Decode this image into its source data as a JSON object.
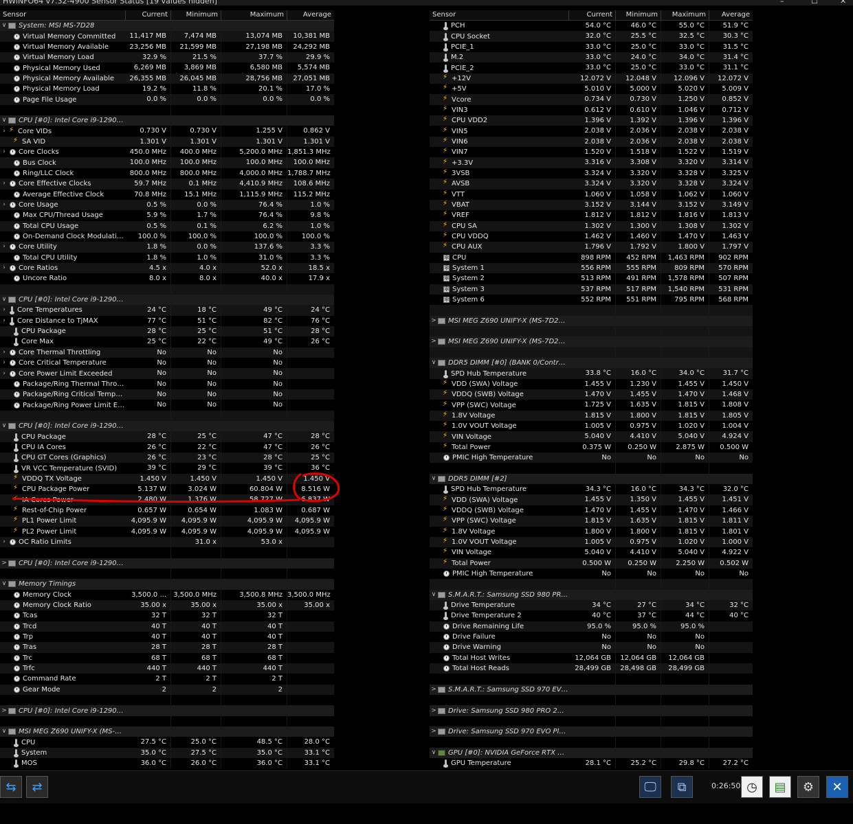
{
  "window": {
    "title": "HWiNFO64 v7.32-4900 Sensor Status [19 values hidden]",
    "min": "–",
    "max": "☐",
    "close": "✕"
  },
  "columns": {
    "sensor": "Sensor",
    "current": "Current",
    "minimum": "Minimum",
    "maximum": "Maximum",
    "average": "Average"
  },
  "left_rows": [
    {
      "t": "g",
      "exp": "∨",
      "name": "System: MSI MS-7D28"
    },
    {
      "ic": "clock",
      "name": "Virtual Memory Committed",
      "v": [
        "11,417 MB",
        "7,474 MB",
        "13,074 MB",
        "10,381 MB"
      ]
    },
    {
      "ic": "clock",
      "name": "Virtual Memory Available",
      "v": [
        "23,256 MB",
        "21,599 MB",
        "27,198 MB",
        "24,292 MB"
      ]
    },
    {
      "ic": "clock",
      "name": "Virtual Memory Load",
      "v": [
        "32.9 %",
        "21.5 %",
        "37.7 %",
        "29.9 %"
      ]
    },
    {
      "ic": "clock",
      "name": "Physical Memory Used",
      "v": [
        "6,269 MB",
        "3,869 MB",
        "6,580 MB",
        "5,574 MB"
      ]
    },
    {
      "ic": "clock",
      "name": "Physical Memory Available",
      "v": [
        "26,355 MB",
        "26,045 MB",
        "28,756 MB",
        "27,051 MB"
      ]
    },
    {
      "ic": "clock",
      "name": "Physical Memory Load",
      "v": [
        "19.2 %",
        "11.8 %",
        "20.1 %",
        "17.0 %"
      ]
    },
    {
      "ic": "clock",
      "name": "Page File Usage",
      "v": [
        "0.0 %",
        "0.0 %",
        "0.0 %",
        "0.0 %"
      ]
    },
    {
      "t": "s"
    },
    {
      "t": "g",
      "exp": "∨",
      "name": "CPU [#0]: Intel Core i9-12900K"
    },
    {
      "sub": true,
      "ic": "volt",
      "name": "Core VIDs",
      "v": [
        "0.730 V",
        "0.730 V",
        "1.255 V",
        "0.862 V"
      ]
    },
    {
      "ic": "volt",
      "name": "SA VID",
      "v": [
        "1.301 V",
        "1.301 V",
        "1.301 V",
        "1.301 V"
      ]
    },
    {
      "sub": true,
      "ic": "clock",
      "name": "Core Clocks",
      "v": [
        "450.0 MHz",
        "400.0 MHz",
        "5,200.0 MHz",
        "1,851.3 MHz"
      ]
    },
    {
      "ic": "clock",
      "name": "Bus Clock",
      "v": [
        "100.0 MHz",
        "100.0 MHz",
        "100.0 MHz",
        "100.0 MHz"
      ]
    },
    {
      "ic": "clock",
      "name": "Ring/LLC Clock",
      "v": [
        "800.0 MHz",
        "800.0 MHz",
        "4,000.0 MHz",
        "1,788.7 MHz"
      ]
    },
    {
      "sub": true,
      "ic": "clock",
      "name": "Core Effective Clocks",
      "v": [
        "59.7 MHz",
        "0.1 MHz",
        "4,410.9 MHz",
        "108.6 MHz"
      ]
    },
    {
      "ic": "clock",
      "name": "Average Effective Clock",
      "v": [
        "70.8 MHz",
        "15.1 MHz",
        "1,115.9 MHz",
        "115.2 MHz"
      ]
    },
    {
      "sub": true,
      "ic": "clock",
      "name": "Core Usage",
      "v": [
        "0.5 %",
        "0.0 %",
        "76.4 %",
        "1.0 %"
      ]
    },
    {
      "ic": "clock",
      "name": "Max CPU/Thread Usage",
      "v": [
        "5.9 %",
        "1.7 %",
        "76.4 %",
        "9.8 %"
      ]
    },
    {
      "ic": "clock",
      "name": "Total CPU Usage",
      "v": [
        "0.5 %",
        "0.1 %",
        "6.2 %",
        "1.0 %"
      ]
    },
    {
      "ic": "clock",
      "name": "On-Demand Clock Modulation",
      "v": [
        "100.0 %",
        "100.0 %",
        "100.0 %",
        "100.0 %"
      ]
    },
    {
      "sub": true,
      "ic": "clock",
      "name": "Core Utility",
      "v": [
        "1.8 %",
        "0.0 %",
        "137.6 %",
        "3.3 %"
      ]
    },
    {
      "ic": "clock",
      "name": "Total CPU Utility",
      "v": [
        "1.8 %",
        "1.0 %",
        "31.0 %",
        "3.3 %"
      ]
    },
    {
      "sub": true,
      "ic": "clock",
      "name": "Core Ratios",
      "v": [
        "4.5 x",
        "4.0 x",
        "52.0 x",
        "18.5 x"
      ]
    },
    {
      "ic": "clock",
      "name": "Uncore Ratio",
      "v": [
        "8.0 x",
        "8.0 x",
        "40.0 x",
        "17.9 x"
      ]
    },
    {
      "t": "s"
    },
    {
      "t": "g",
      "exp": "∨",
      "name": "CPU [#0]: Intel Core i9-12900..."
    },
    {
      "sub": true,
      "ic": "temp",
      "name": "Core Temperatures",
      "v": [
        "24 °C",
        "18 °C",
        "49 °C",
        "24 °C"
      ]
    },
    {
      "sub": true,
      "ic": "temp",
      "name": "Core Distance to TjMAX",
      "v": [
        "77 °C",
        "51 °C",
        "82 °C",
        "76 °C"
      ]
    },
    {
      "ic": "temp",
      "name": "CPU Package",
      "v": [
        "28 °C",
        "25 °C",
        "51 °C",
        "28 °C"
      ]
    },
    {
      "ic": "temp",
      "name": "Core Max",
      "v": [
        "25 °C",
        "22 °C",
        "49 °C",
        "26 °C"
      ]
    },
    {
      "sub": true,
      "ic": "clock",
      "name": "Core Thermal Throttling",
      "v": [
        "No",
        "No",
        "No",
        ""
      ]
    },
    {
      "sub": true,
      "ic": "clock",
      "name": "Core Critical Temperature",
      "v": [
        "No",
        "No",
        "No",
        ""
      ]
    },
    {
      "sub": true,
      "ic": "clock",
      "name": "Core Power Limit Exceeded",
      "v": [
        "No",
        "No",
        "No",
        ""
      ]
    },
    {
      "ic": "clock",
      "name": "Package/Ring Thermal Throttling",
      "v": [
        "No",
        "No",
        "No",
        ""
      ]
    },
    {
      "ic": "clock",
      "name": "Package/Ring Critical Temperat...",
      "v": [
        "No",
        "No",
        "No",
        ""
      ]
    },
    {
      "ic": "clock",
      "name": "Package/Ring Power Limit Exce...",
      "v": [
        "No",
        "No",
        "No",
        ""
      ]
    },
    {
      "t": "s"
    },
    {
      "t": "g",
      "exp": "∨",
      "name": "CPU [#0]: Intel Core i9-12900..."
    },
    {
      "ic": "temp",
      "name": "CPU Package",
      "v": [
        "28 °C",
        "25 °C",
        "47 °C",
        "28 °C"
      ]
    },
    {
      "ic": "temp",
      "name": "CPU IA Cores",
      "v": [
        "26 °C",
        "22 °C",
        "47 °C",
        "26 °C"
      ]
    },
    {
      "ic": "temp",
      "name": "CPU GT Cores (Graphics)",
      "v": [
        "26 °C",
        "23 °C",
        "28 °C",
        "25 °C"
      ]
    },
    {
      "ic": "temp",
      "name": "VR VCC Temperature (SVID)",
      "v": [
        "39 °C",
        "29 °C",
        "39 °C",
        "36 °C"
      ]
    },
    {
      "ic": "volt",
      "name": "VDDQ TX Voltage",
      "v": [
        "1.450 V",
        "1.450 V",
        "1.450 V",
        "1.450 V"
      ]
    },
    {
      "ic": "volt",
      "name": "CPU Package Power",
      "v": [
        "5.137 W",
        "3.024 W",
        "60.804 W",
        "8.516 W"
      ]
    },
    {
      "ic": "volt",
      "name": "IA Cores Power",
      "v": [
        "2.480 W",
        "1.376 W",
        "58.727 W",
        "6.837 W"
      ]
    },
    {
      "ic": "volt",
      "name": "Rest-of-Chip Power",
      "v": [
        "0.657 W",
        "0.654 W",
        "1.083 W",
        "0.687 W"
      ]
    },
    {
      "ic": "volt",
      "name": "PL1 Power Limit",
      "v": [
        "4,095.9 W",
        "4,095.9 W",
        "4,095.9 W",
        "4,095.9 W"
      ]
    },
    {
      "ic": "volt",
      "name": "PL2 Power Limit",
      "v": [
        "4,095.9 W",
        "4,095.9 W",
        "4,095.9 W",
        "4,095.9 W"
      ]
    },
    {
      "sub": true,
      "ic": "clock",
      "name": "OC Ratio Limits",
      "v": [
        "",
        "31.0 x",
        "53.0 x",
        ""
      ]
    },
    {
      "t": "s"
    },
    {
      "t": "g",
      "exp": ">",
      "name": "CPU [#0]: Intel Core i9-12900..."
    },
    {
      "t": "s"
    },
    {
      "t": "g",
      "exp": "∨",
      "name": "Memory Timings"
    },
    {
      "ic": "clock",
      "name": "Memory Clock",
      "v": [
        "3,500.0 ...",
        "3,500.0 MHz",
        "3,500.8 MHz",
        "3,500.0 MHz"
      ]
    },
    {
      "ic": "clock",
      "name": "Memory Clock Ratio",
      "v": [
        "35.00 x",
        "35.00 x",
        "35.00 x",
        "35.00 x"
      ]
    },
    {
      "ic": "clock",
      "name": "Tcas",
      "v": [
        "32 T",
        "32 T",
        "32 T",
        ""
      ]
    },
    {
      "ic": "clock",
      "name": "Trcd",
      "v": [
        "40 T",
        "40 T",
        "40 T",
        ""
      ]
    },
    {
      "ic": "clock",
      "name": "Trp",
      "v": [
        "40 T",
        "40 T",
        "40 T",
        ""
      ]
    },
    {
      "ic": "clock",
      "name": "Tras",
      "v": [
        "28 T",
        "28 T",
        "28 T",
        ""
      ]
    },
    {
      "ic": "clock",
      "name": "Trc",
      "v": [
        "68 T",
        "68 T",
        "68 T",
        ""
      ]
    },
    {
      "ic": "clock",
      "name": "Trfc",
      "v": [
        "440 T",
        "440 T",
        "440 T",
        ""
      ]
    },
    {
      "ic": "clock",
      "name": "Command Rate",
      "v": [
        "2 T",
        "2 T",
        "2 T",
        ""
      ]
    },
    {
      "ic": "clock",
      "name": "Gear Mode",
      "v": [
        "2",
        "2",
        "2",
        ""
      ]
    },
    {
      "t": "s"
    },
    {
      "t": "g",
      "exp": ">",
      "name": "CPU [#0]: Intel Core i9-12900..."
    },
    {
      "t": "s"
    },
    {
      "t": "g",
      "exp": "∨",
      "name": "MSI MEG Z690 UNIFY-X (MS-7..."
    },
    {
      "ic": "temp",
      "name": "CPU",
      "v": [
        "27.5 °C",
        "25.0 °C",
        "48.5 °C",
        "28.0 °C"
      ]
    },
    {
      "ic": "temp",
      "name": "System",
      "v": [
        "35.0 °C",
        "27.5 °C",
        "35.0 °C",
        "33.1 °C"
      ]
    },
    {
      "ic": "temp",
      "name": "MOS",
      "v": [
        "36.0 °C",
        "26.0 °C",
        "36.0 °C",
        "33.1 °C"
      ]
    }
  ],
  "right_rows": [
    {
      "ic": "temp",
      "name": "PCH",
      "v": [
        "54.0 °C",
        "46.0 °C",
        "55.0 °C",
        "51.9 °C"
      ]
    },
    {
      "ic": "temp",
      "name": "CPU Socket",
      "v": [
        "32.0 °C",
        "25.5 °C",
        "32.5 °C",
        "30.3 °C"
      ]
    },
    {
      "ic": "temp",
      "name": "PCIE_1",
      "v": [
        "33.0 °C",
        "25.0 °C",
        "33.0 °C",
        "31.5 °C"
      ]
    },
    {
      "ic": "temp",
      "name": "M.2",
      "v": [
        "33.0 °C",
        "24.0 °C",
        "34.0 °C",
        "31.4 °C"
      ]
    },
    {
      "ic": "temp",
      "name": "PCIE_2",
      "v": [
        "33.0 °C",
        "25.0 °C",
        "33.0 °C",
        "31.1 °C"
      ]
    },
    {
      "ic": "volt",
      "name": "+12V",
      "v": [
        "12.072 V",
        "12.048 V",
        "12.096 V",
        "12.072 V"
      ]
    },
    {
      "ic": "volt",
      "name": "+5V",
      "v": [
        "5.010 V",
        "5.000 V",
        "5.020 V",
        "5.009 V"
      ]
    },
    {
      "ic": "volt",
      "name": "Vcore",
      "v": [
        "0.734 V",
        "0.730 V",
        "1.250 V",
        "0.852 V"
      ]
    },
    {
      "ic": "volt",
      "name": "VIN3",
      "v": [
        "0.612 V",
        "0.610 V",
        "1.046 V",
        "0.712 V"
      ]
    },
    {
      "ic": "volt",
      "name": "CPU VDD2",
      "v": [
        "1.396 V",
        "1.392 V",
        "1.396 V",
        "1.396 V"
      ]
    },
    {
      "ic": "volt",
      "name": "VIN5",
      "v": [
        "2.038 V",
        "2.036 V",
        "2.038 V",
        "2.038 V"
      ]
    },
    {
      "ic": "volt",
      "name": "VIN6",
      "v": [
        "2.038 V",
        "2.036 V",
        "2.038 V",
        "2.038 V"
      ]
    },
    {
      "ic": "volt",
      "name": "VIN7",
      "v": [
        "1.520 V",
        "1.518 V",
        "1.522 V",
        "1.519 V"
      ]
    },
    {
      "ic": "volt",
      "name": "+3.3V",
      "v": [
        "3.316 V",
        "3.308 V",
        "3.320 V",
        "3.314 V"
      ]
    },
    {
      "ic": "volt",
      "name": "3VSB",
      "v": [
        "3.324 V",
        "3.320 V",
        "3.328 V",
        "3.325 V"
      ]
    },
    {
      "ic": "volt",
      "name": "AVSB",
      "v": [
        "3.324 V",
        "3.320 V",
        "3.328 V",
        "3.324 V"
      ]
    },
    {
      "ic": "volt",
      "name": "VTT",
      "v": [
        "1.060 V",
        "1.058 V",
        "1.062 V",
        "1.060 V"
      ]
    },
    {
      "ic": "volt",
      "name": "VBAT",
      "v": [
        "3.152 V",
        "3.144 V",
        "3.152 V",
        "3.149 V"
      ]
    },
    {
      "ic": "volt",
      "name": "VREF",
      "v": [
        "1.812 V",
        "1.812 V",
        "1.816 V",
        "1.813 V"
      ]
    },
    {
      "ic": "volt",
      "name": "CPU SA",
      "v": [
        "1.302 V",
        "1.300 V",
        "1.308 V",
        "1.302 V"
      ]
    },
    {
      "ic": "volt",
      "name": "CPU VDDQ",
      "v": [
        "1.462 V",
        "1.460 V",
        "1.470 V",
        "1.463 V"
      ]
    },
    {
      "ic": "volt",
      "name": "CPU AUX",
      "v": [
        "1.796 V",
        "1.792 V",
        "1.800 V",
        "1.797 V"
      ]
    },
    {
      "ic": "fan",
      "name": "CPU",
      "v": [
        "898 RPM",
        "452 RPM",
        "1,463 RPM",
        "902 RPM"
      ]
    },
    {
      "ic": "fan",
      "name": "System 1",
      "v": [
        "556 RPM",
        "555 RPM",
        "809 RPM",
        "570 RPM"
      ]
    },
    {
      "ic": "fan",
      "name": "System 2",
      "v": [
        "513 RPM",
        "491 RPM",
        "1,578 RPM",
        "507 RPM"
      ]
    },
    {
      "ic": "fan",
      "name": "System 3",
      "v": [
        "537 RPM",
        "517 RPM",
        "1,540 RPM",
        "531 RPM"
      ]
    },
    {
      "ic": "fan",
      "name": "System 6",
      "v": [
        "552 RPM",
        "551 RPM",
        "795 RPM",
        "568 RPM"
      ]
    },
    {
      "t": "s"
    },
    {
      "t": "g",
      "exp": ">",
      "name": "MSI MEG Z690 UNIFY-X (MS-7D28) ..."
    },
    {
      "t": "s"
    },
    {
      "t": "g",
      "exp": ">",
      "name": "MSI MEG Z690 UNIFY-X (MS-7D28) ..."
    },
    {
      "t": "s"
    },
    {
      "t": "g",
      "exp": "∨",
      "name": "DDR5 DIMM [#0] (BANK 0/Controll..."
    },
    {
      "ic": "temp",
      "name": "SPD Hub Temperature",
      "v": [
        "33.8 °C",
        "16.0 °C",
        "34.0 °C",
        "31.7 °C"
      ]
    },
    {
      "ic": "volt",
      "name": "VDD (SWA) Voltage",
      "v": [
        "1.455 V",
        "1.230 V",
        "1.455 V",
        "1.450 V"
      ]
    },
    {
      "ic": "volt",
      "name": "VDDQ (SWB) Voltage",
      "v": [
        "1.470 V",
        "1.455 V",
        "1.470 V",
        "1.468 V"
      ]
    },
    {
      "ic": "volt",
      "name": "VPP (SWC) Voltage",
      "v": [
        "1.725 V",
        "1.635 V",
        "1.815 V",
        "1.808 V"
      ]
    },
    {
      "ic": "volt",
      "name": "1.8V Voltage",
      "v": [
        "1.815 V",
        "1.800 V",
        "1.815 V",
        "1.805 V"
      ]
    },
    {
      "ic": "volt",
      "name": "1.0V VOUT Voltage",
      "v": [
        "1.005 V",
        "0.975 V",
        "1.020 V",
        "1.004 V"
      ]
    },
    {
      "ic": "volt",
      "name": "VIN Voltage",
      "v": [
        "5.040 V",
        "4.410 V",
        "5.040 V",
        "4.924 V"
      ]
    },
    {
      "ic": "volt",
      "name": "Total Power",
      "v": [
        "0.375 W",
        "0.250 W",
        "2.875 W",
        "0.500 W"
      ]
    },
    {
      "ic": "clock",
      "name": "PMIC High Temperature",
      "v": [
        "No",
        "No",
        "No",
        "No"
      ]
    },
    {
      "t": "s"
    },
    {
      "t": "g",
      "exp": "∨",
      "name": "DDR5 DIMM [#2]"
    },
    {
      "ic": "temp",
      "name": "SPD Hub Temperature",
      "v": [
        "34.3 °C",
        "16.0 °C",
        "34.3 °C",
        "32.0 °C"
      ]
    },
    {
      "ic": "volt",
      "name": "VDD (SWA) Voltage",
      "v": [
        "1.455 V",
        "1.350 V",
        "1.455 V",
        "1.451 V"
      ]
    },
    {
      "ic": "volt",
      "name": "VDDQ (SWB) Voltage",
      "v": [
        "1.470 V",
        "1.455 V",
        "1.470 V",
        "1.466 V"
      ]
    },
    {
      "ic": "volt",
      "name": "VPP (SWC) Voltage",
      "v": [
        "1.815 V",
        "1.635 V",
        "1.815 V",
        "1.811 V"
      ]
    },
    {
      "ic": "volt",
      "name": "1.8V Voltage",
      "v": [
        "1.800 V",
        "1.800 V",
        "1.815 V",
        "1.801 V"
      ]
    },
    {
      "ic": "volt",
      "name": "1.0V VOUT Voltage",
      "v": [
        "1.005 V",
        "0.975 V",
        "1.020 V",
        "1.000 V"
      ]
    },
    {
      "ic": "volt",
      "name": "VIN Voltage",
      "v": [
        "5.040 V",
        "4.410 V",
        "5.040 V",
        "4.922 V"
      ]
    },
    {
      "ic": "volt",
      "name": "Total Power",
      "v": [
        "0.500 W",
        "0.250 W",
        "2.250 W",
        "0.502 W"
      ]
    },
    {
      "ic": "clock",
      "name": "PMIC High Temperature",
      "v": [
        "No",
        "No",
        "No",
        "No"
      ]
    },
    {
      "t": "s"
    },
    {
      "t": "g",
      "exp": "∨",
      "name": "S.M.A.R.T.: Samsung SSD 980 PR..."
    },
    {
      "ic": "temp",
      "name": "Drive Temperature",
      "v": [
        "34 °C",
        "27 °C",
        "34 °C",
        "32 °C"
      ]
    },
    {
      "ic": "temp",
      "name": "Drive Temperature 2",
      "v": [
        "40 °C",
        "37 °C",
        "44 °C",
        "40 °C"
      ]
    },
    {
      "ic": "clock",
      "name": "Drive Remaining Life",
      "v": [
        "95.0 %",
        "95.0 %",
        "95.0 %",
        ""
      ]
    },
    {
      "ic": "clock",
      "name": "Drive Failure",
      "v": [
        "No",
        "No",
        "No",
        ""
      ]
    },
    {
      "ic": "clock",
      "name": "Drive Warning",
      "v": [
        "No",
        "No",
        "No",
        ""
      ]
    },
    {
      "ic": "clock",
      "name": "Total Host Writes",
      "v": [
        "12,064 GB",
        "12,064 GB",
        "12,064 GB",
        ""
      ]
    },
    {
      "ic": "clock",
      "name": "Total Host Reads",
      "v": [
        "28,499 GB",
        "28,498 GB",
        "28,499 GB",
        ""
      ]
    },
    {
      "t": "s"
    },
    {
      "t": "g",
      "exp": ">",
      "name": "S.M.A.R.T.: Samsung SSD 970 EVO..."
    },
    {
      "t": "s"
    },
    {
      "t": "g",
      "exp": ">",
      "name": "Drive: Samsung SSD 980 PRO 250G..."
    },
    {
      "t": "s"
    },
    {
      "t": "g",
      "exp": ">",
      "name": "Drive: Samsung SSD 970 EVO Plus ..."
    },
    {
      "t": "s"
    },
    {
      "t": "g",
      "exp": "∨",
      "gpu": true,
      "name": "GPU [#0]: NVIDIA GeForce RTX 40..."
    },
    {
      "ic": "temp",
      "name": "GPU Temperature",
      "v": [
        "28.1 °C",
        "25.2 °C",
        "29.8 °C",
        "27.2 °C"
      ]
    }
  ],
  "toolbar": {
    "timer": "0:26:50"
  },
  "annotation_color": "#e00000"
}
